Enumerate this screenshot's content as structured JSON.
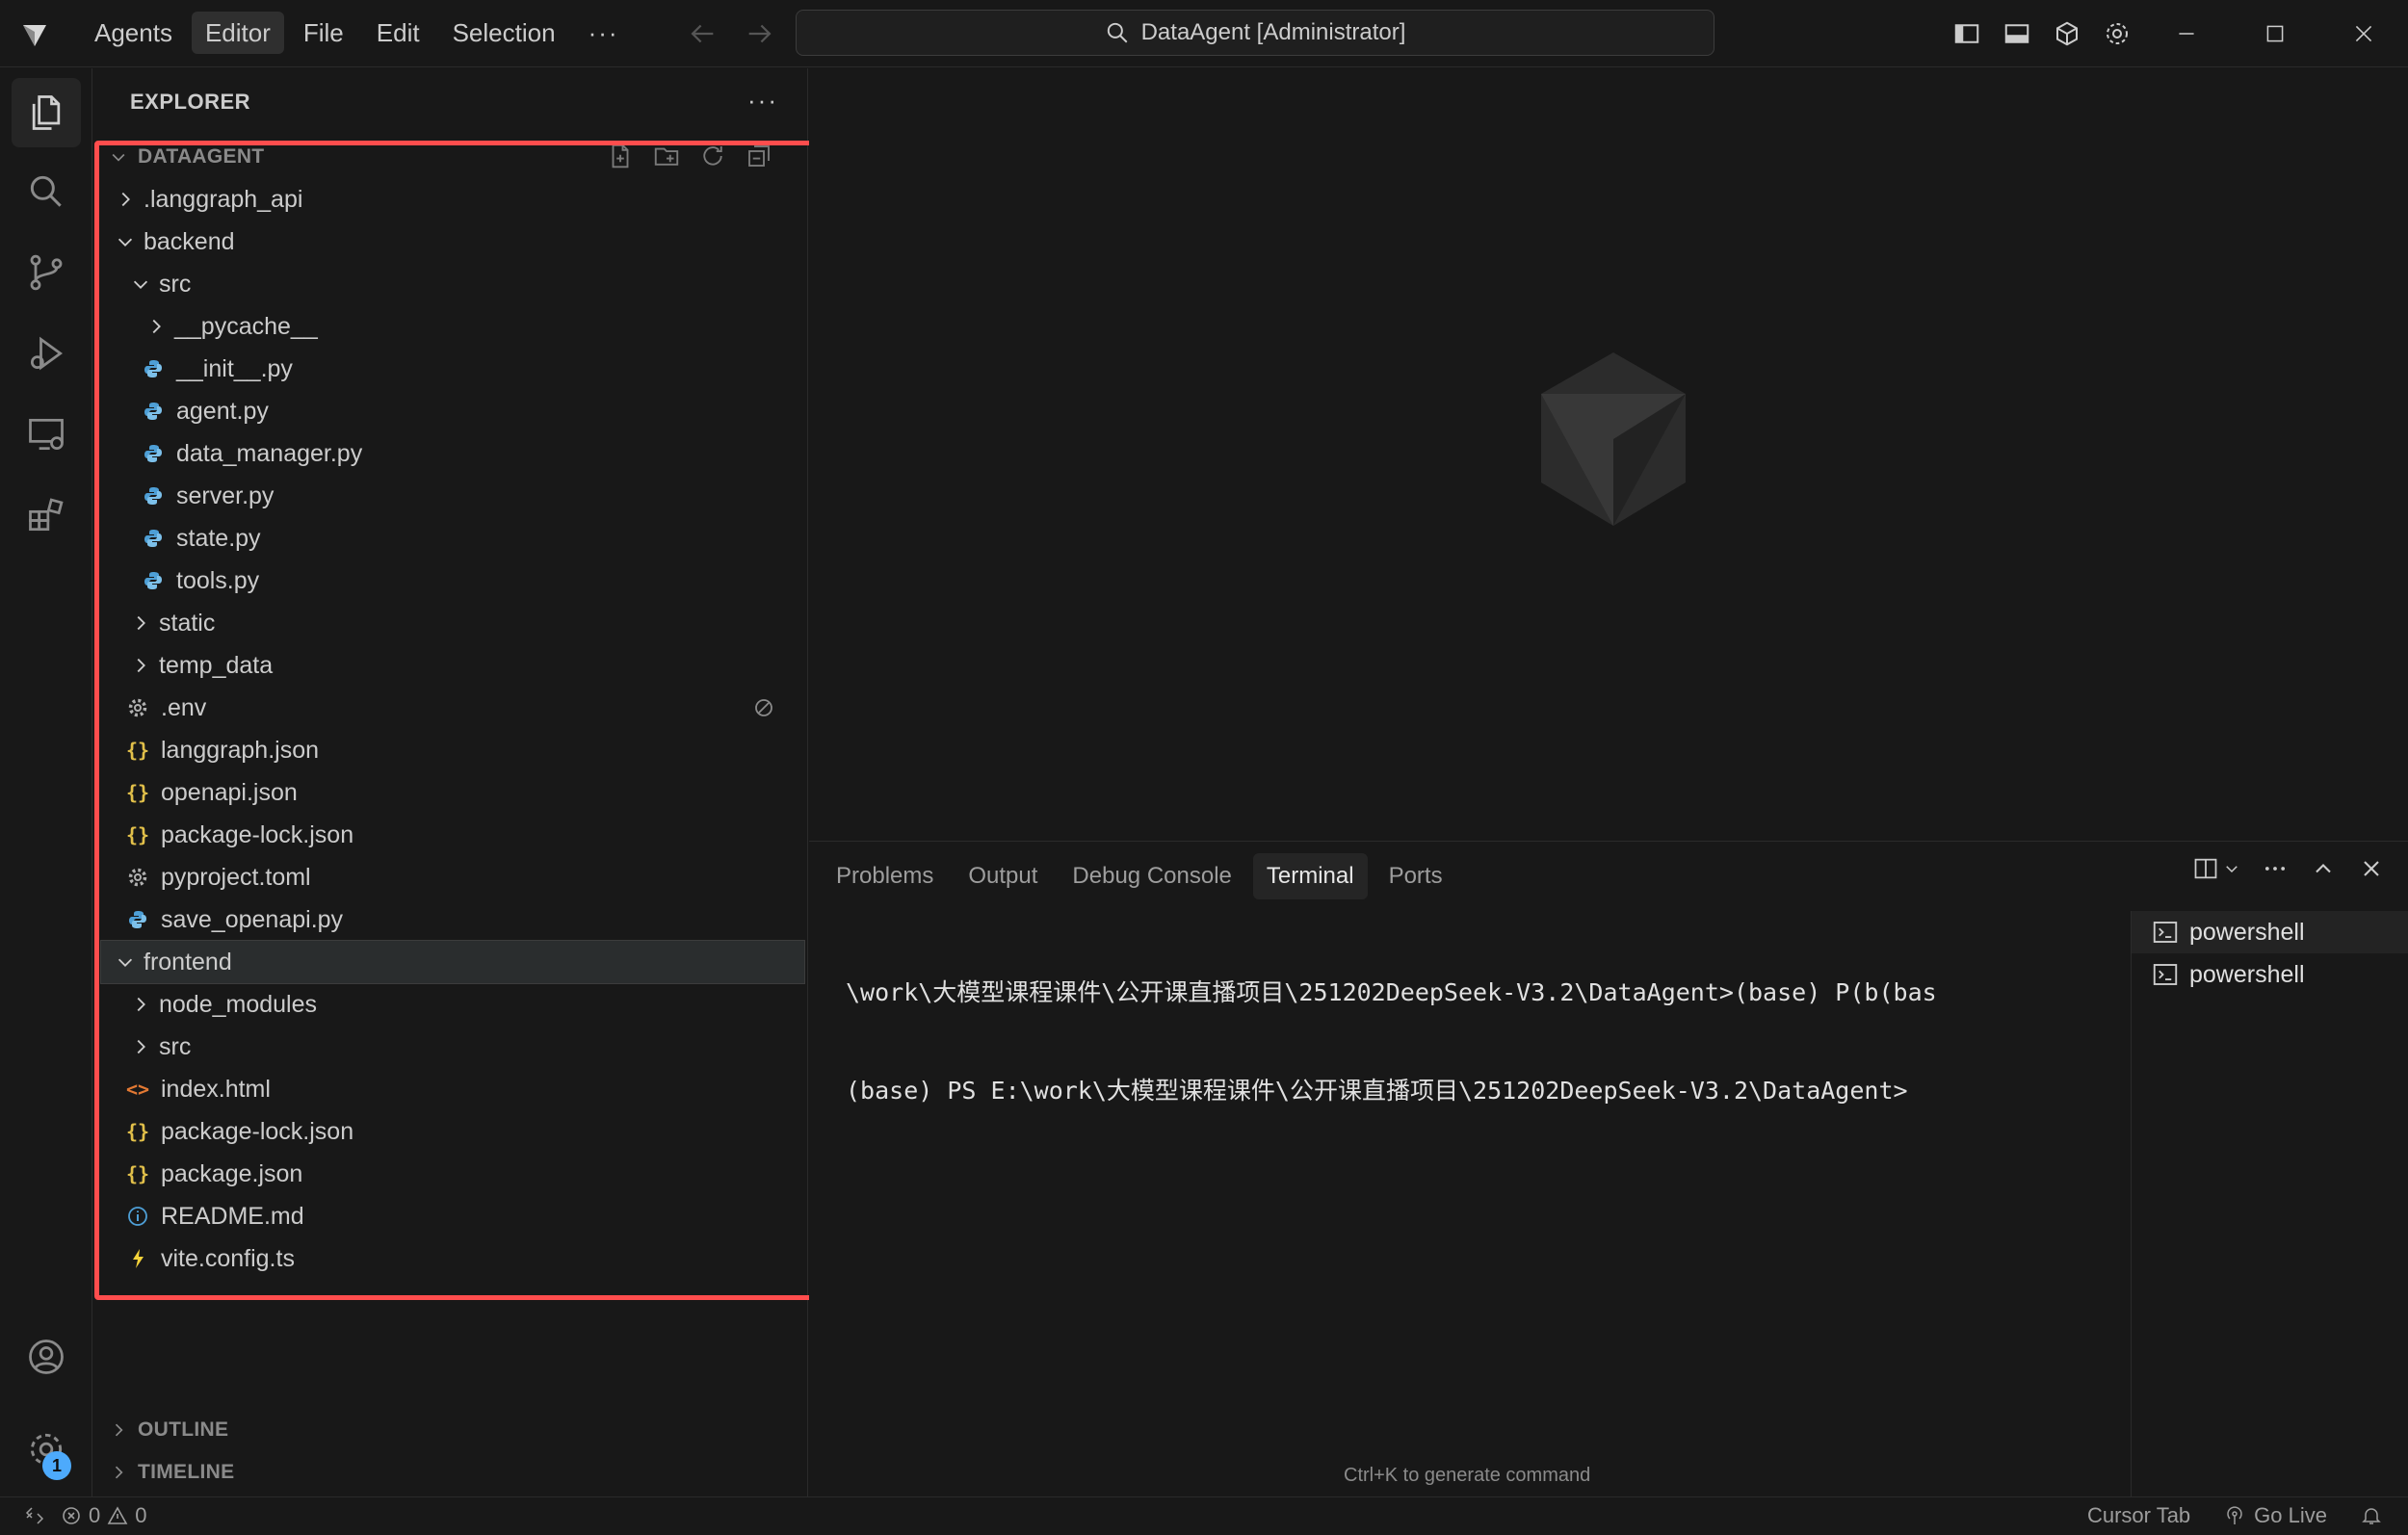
{
  "menu": {
    "agents": "Agents",
    "editor": "Editor",
    "file": "File",
    "edit": "Edit",
    "selection": "Selection",
    "more": "···"
  },
  "search": {
    "title": "DataAgent [Administrator]"
  },
  "explorer": {
    "header": "EXPLORER",
    "more": "···",
    "root": "DATAAGENT",
    "tree": [
      {
        "label": ".langgraph_api",
        "depth": 1,
        "kind": "folder-closed"
      },
      {
        "label": "backend",
        "depth": 1,
        "kind": "folder-open"
      },
      {
        "label": "src",
        "depth": 2,
        "kind": "folder-open"
      },
      {
        "label": "__pycache__",
        "depth": 3,
        "kind": "folder-closed"
      },
      {
        "label": "__init__.py",
        "depth": 3,
        "kind": "python"
      },
      {
        "label": "agent.py",
        "depth": 3,
        "kind": "python"
      },
      {
        "label": "data_manager.py",
        "depth": 3,
        "kind": "python"
      },
      {
        "label": "server.py",
        "depth": 3,
        "kind": "python"
      },
      {
        "label": "state.py",
        "depth": 3,
        "kind": "python"
      },
      {
        "label": "tools.py",
        "depth": 3,
        "kind": "python"
      },
      {
        "label": "static",
        "depth": 2,
        "kind": "folder-closed"
      },
      {
        "label": "temp_data",
        "depth": 2,
        "kind": "folder-closed"
      },
      {
        "label": ".env",
        "depth": 2,
        "kind": "gear",
        "trail": "ignored"
      },
      {
        "label": "langgraph.json",
        "depth": 2,
        "kind": "json"
      },
      {
        "label": "openapi.json",
        "depth": 2,
        "kind": "json"
      },
      {
        "label": "package-lock.json",
        "depth": 2,
        "kind": "json"
      },
      {
        "label": "pyproject.toml",
        "depth": 2,
        "kind": "gear"
      },
      {
        "label": "save_openapi.py",
        "depth": 2,
        "kind": "python"
      },
      {
        "label": "frontend",
        "depth": 1,
        "kind": "folder-open",
        "selected": true
      },
      {
        "label": "node_modules",
        "depth": 2,
        "kind": "folder-closed"
      },
      {
        "label": "src",
        "depth": 2,
        "kind": "folder-closed"
      },
      {
        "label": "index.html",
        "depth": 2,
        "kind": "html"
      },
      {
        "label": "package-lock.json",
        "depth": 2,
        "kind": "json"
      },
      {
        "label": "package.json",
        "depth": 2,
        "kind": "json"
      },
      {
        "label": "README.md",
        "depth": 2,
        "kind": "info"
      },
      {
        "label": "vite.config.ts",
        "depth": 2,
        "kind": "vite"
      }
    ],
    "outline": "OUTLINE",
    "timeline": "TIMELINE"
  },
  "panel": {
    "tabs": [
      "Problems",
      "Output",
      "Debug Console",
      "Terminal",
      "Ports"
    ],
    "active_tab": "Terminal",
    "terminal_lines": [
      "\\work\\大模型课程课件\\公开课直播项目\\251202DeepSeek-V3.2\\DataAgent>(base) P(b(bas",
      "(base) PS E:\\work\\大模型课程课件\\公开课直播项目\\251202DeepSeek-V3.2\\DataAgent>"
    ],
    "terminals": [
      "powershell",
      "powershell"
    ],
    "hint": "Ctrl+K to generate command"
  },
  "status": {
    "errors": "0",
    "warnings": "0",
    "cursor_tab": "Cursor Tab",
    "go_live": "Go Live"
  },
  "accounts_badge": "1",
  "colors": {
    "highlight": "#ff4d4d",
    "python": "#4e9fd6",
    "json": "#e2c04a",
    "html": "#e37933",
    "badge": "#4daafc"
  }
}
